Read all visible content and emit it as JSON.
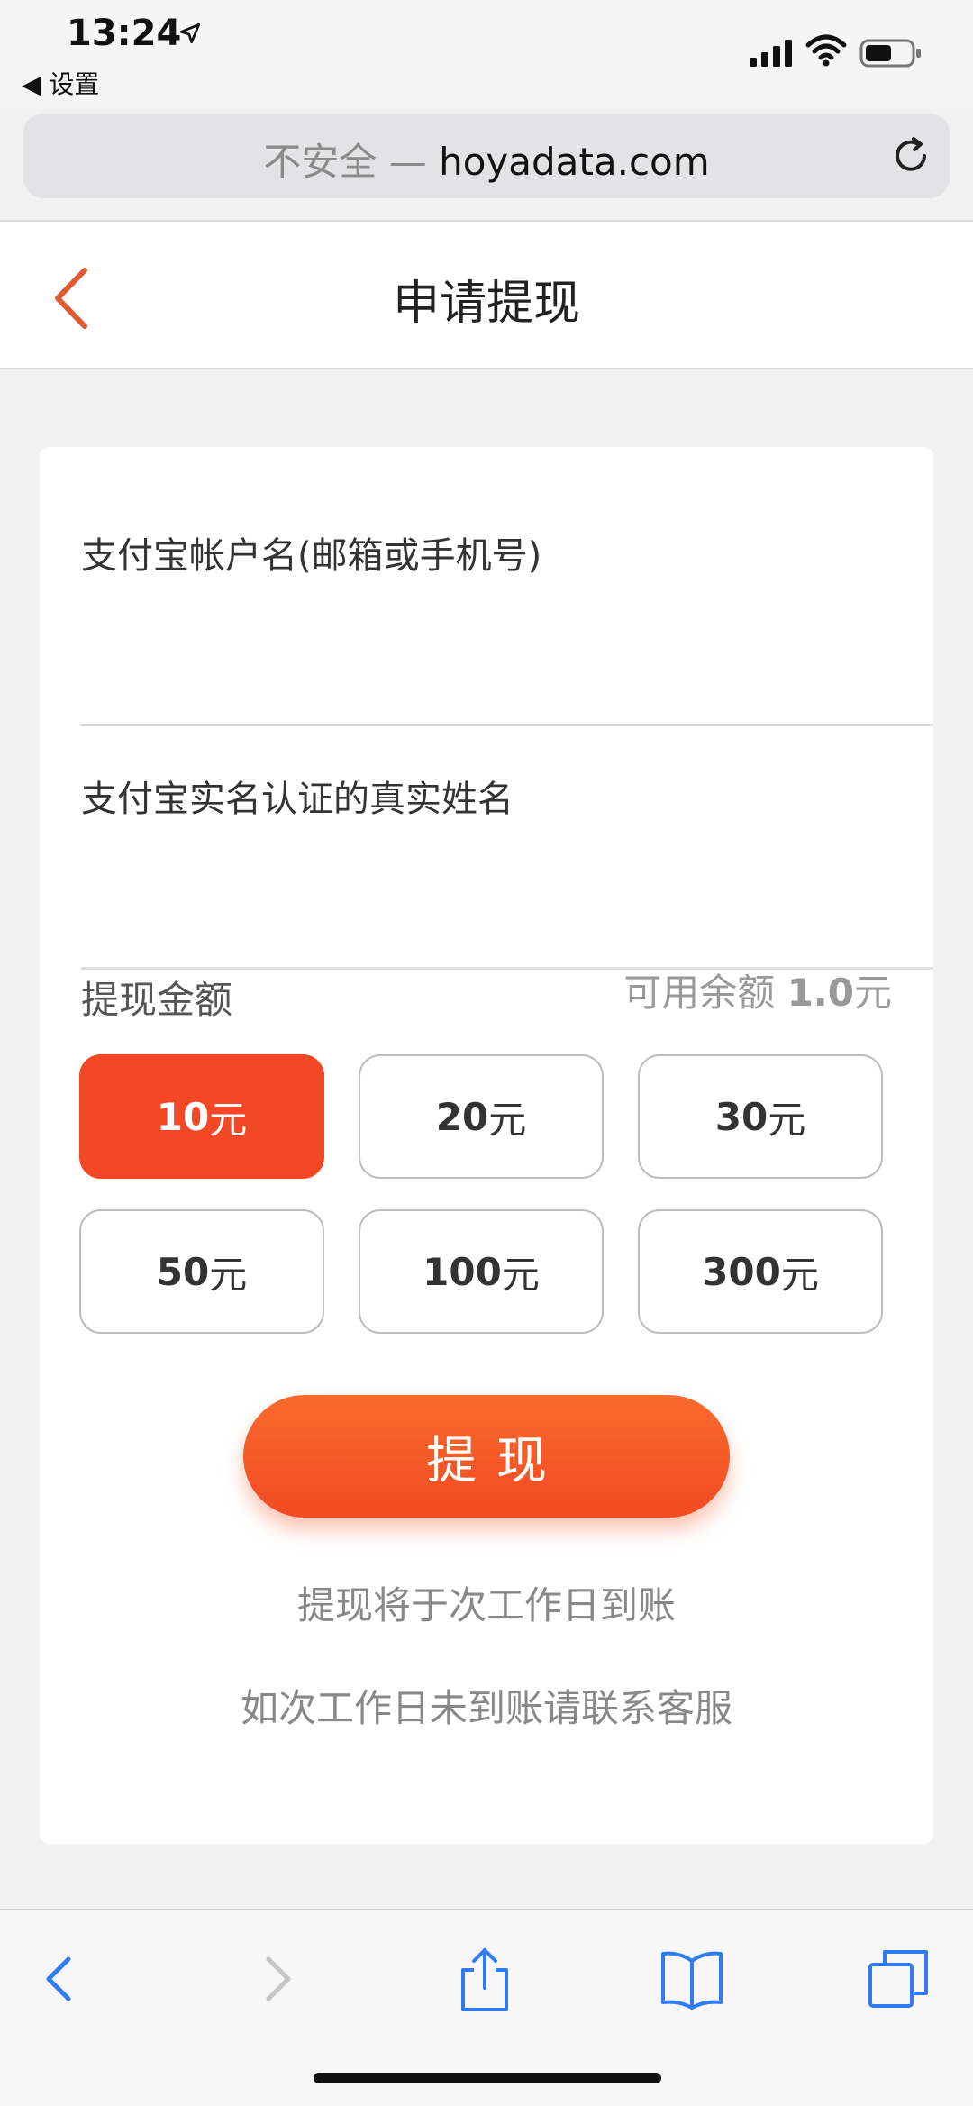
{
  "status_bar": {
    "time": "13:24",
    "back_app": "◀ 设置"
  },
  "browser": {
    "insecure_label": "不安全",
    "separator": " — ",
    "domain": "hoyadata.com"
  },
  "header": {
    "title": "申请提现"
  },
  "form": {
    "alipay_account_placeholder": "支付宝帐户名(邮箱或手机号)",
    "real_name_placeholder": "支付宝实名认证的真实姓名",
    "amount_label": "提现金额",
    "balance_prefix": "可用余额 ",
    "balance_value": "1.0",
    "balance_unit": "元",
    "amounts": [
      {
        "num": "10",
        "unit": "元",
        "selected": true
      },
      {
        "num": "20",
        "unit": "元",
        "selected": false
      },
      {
        "num": "30",
        "unit": "元",
        "selected": false
      },
      {
        "num": "50",
        "unit": "元",
        "selected": false
      },
      {
        "num": "100",
        "unit": "元",
        "selected": false
      },
      {
        "num": "300",
        "unit": "元",
        "selected": false
      }
    ],
    "submit_label": "提现",
    "note_1": "提现将于次工作日到账",
    "note_2": "如次工作日未到账请联系客服"
  },
  "colors": {
    "accent": "#f44725",
    "icon_blue": "#2f7cf6"
  }
}
